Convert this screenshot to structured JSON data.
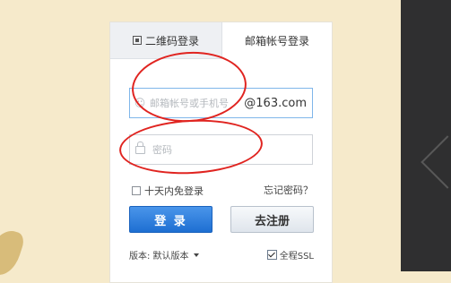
{
  "tabs": {
    "qr": {
      "label": "二维码登录",
      "icon": "qr-code-icon"
    },
    "email": {
      "label": "邮箱帐号登录"
    }
  },
  "form": {
    "account": {
      "placeholder": "邮箱帐号或手机号",
      "suffix": "@163.com",
      "value": ""
    },
    "password": {
      "placeholder": "密码",
      "value": ""
    }
  },
  "options": {
    "remember_label": "十天内免登录",
    "remember_checked": false,
    "forgot_label": "忘记密码？"
  },
  "buttons": {
    "login_label": "登 录",
    "register_label": "去注册"
  },
  "footer": {
    "version_label": "版本: 默认版本",
    "ssl_label": "全程SSL",
    "ssl_checked": true
  },
  "colors": {
    "page_bg": "#f6eacb",
    "annotation": "#e02420",
    "login_button": "#2a7fe0"
  }
}
